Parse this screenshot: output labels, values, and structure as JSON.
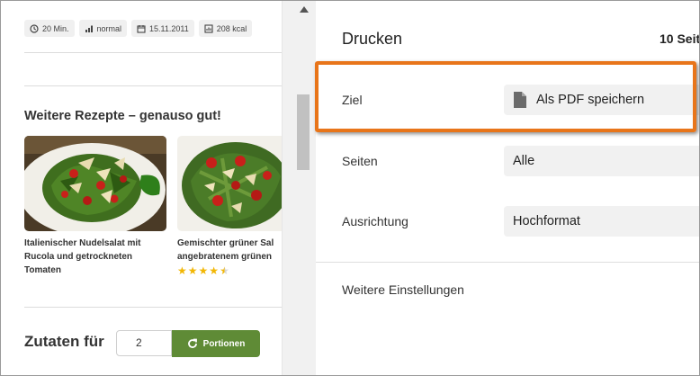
{
  "preview": {
    "meta": [
      {
        "icon": "clock-icon",
        "label": "20 Min."
      },
      {
        "icon": "signal-bars-icon",
        "label": "normal"
      },
      {
        "icon": "calendar-icon",
        "label": "15.11.2011"
      },
      {
        "icon": "calories-icon",
        "label": "208 kcal"
      }
    ],
    "section_title": "Weitere Rezepte – genauso gut!",
    "cards": [
      {
        "title": "Italienischer Nudelsalat mit\nRucola und getrockneten\nTomaten"
      },
      {
        "title": "Gemischter grüner Sal\nangebratenem grünen",
        "rating": 4.5
      }
    ],
    "zutaten_label": "Zutaten für",
    "portion_value": "2",
    "portion_button": "Portionen",
    "colors": {
      "button_green": "#5f8b36",
      "star": "#f2b705"
    }
  },
  "print": {
    "title": "Drucken",
    "pages_count": "10 Seit",
    "rows": [
      {
        "label": "Ziel",
        "value": "Als PDF speichern",
        "icon": "document-icon"
      },
      {
        "label": "Seiten",
        "value": "Alle"
      },
      {
        "label": "Ausrichtung",
        "value": "Hochformat"
      }
    ],
    "more_settings": "Weitere Einstellungen",
    "highlight_color": "#e8751a"
  }
}
